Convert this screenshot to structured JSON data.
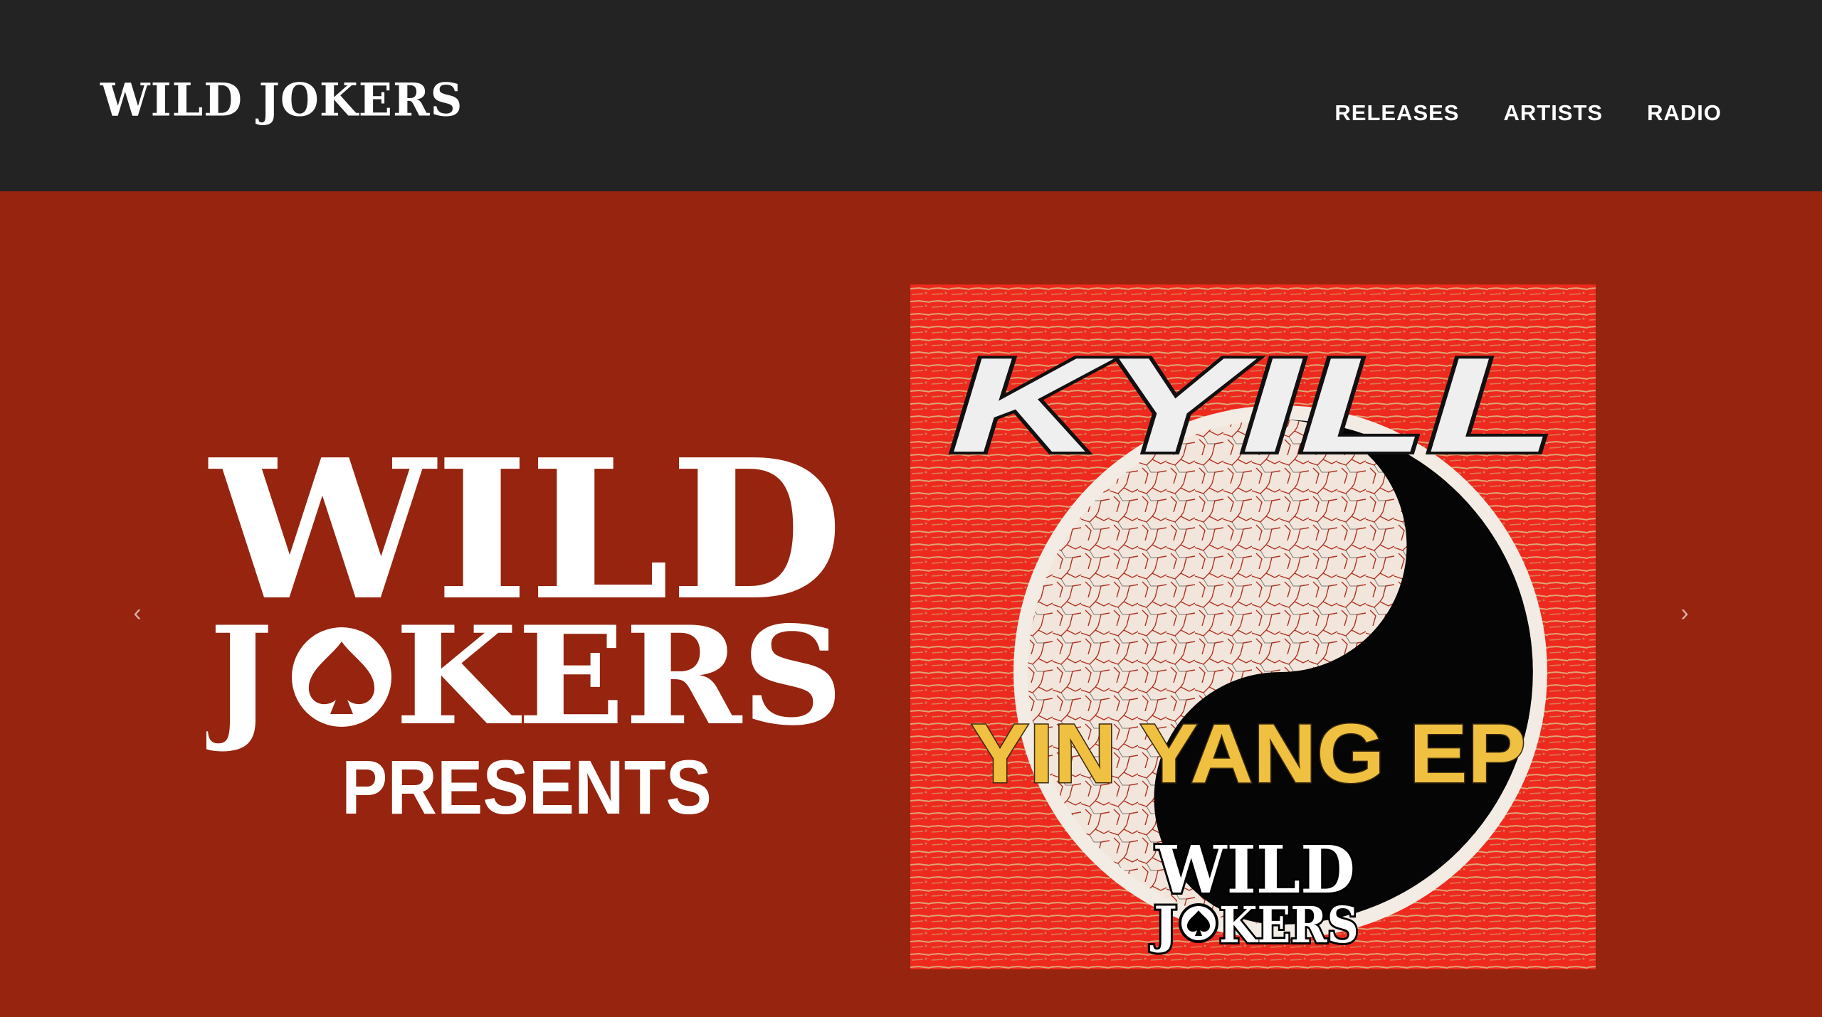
{
  "header": {
    "brand": "WILD JOKERS",
    "nav": [
      {
        "label": "RELEASES"
      },
      {
        "label": "ARTISTS"
      },
      {
        "label": "RADIO"
      }
    ]
  },
  "slider": {
    "prev_icon": "chevron-left-icon",
    "next_icon": "chevron-right-icon",
    "prev_glyph": "‹",
    "next_glyph": "›"
  },
  "slide": {
    "logo_line1": "WILD",
    "logo_line2_left": "J",
    "logo_line2_right": "KERS",
    "presents": "PRESENTS",
    "cover": {
      "artist": "KYILL",
      "title": "YIN YANG EP",
      "label_line1": "WILD",
      "label_line2_left": "J",
      "label_line2_right": "KERS"
    }
  },
  "colors": {
    "header_bg": "#232323",
    "hero_bg": "#96240f",
    "cover_red": "#ee2a1e",
    "cover_gold": "#f0c040",
    "text_white": "#ffffff"
  }
}
